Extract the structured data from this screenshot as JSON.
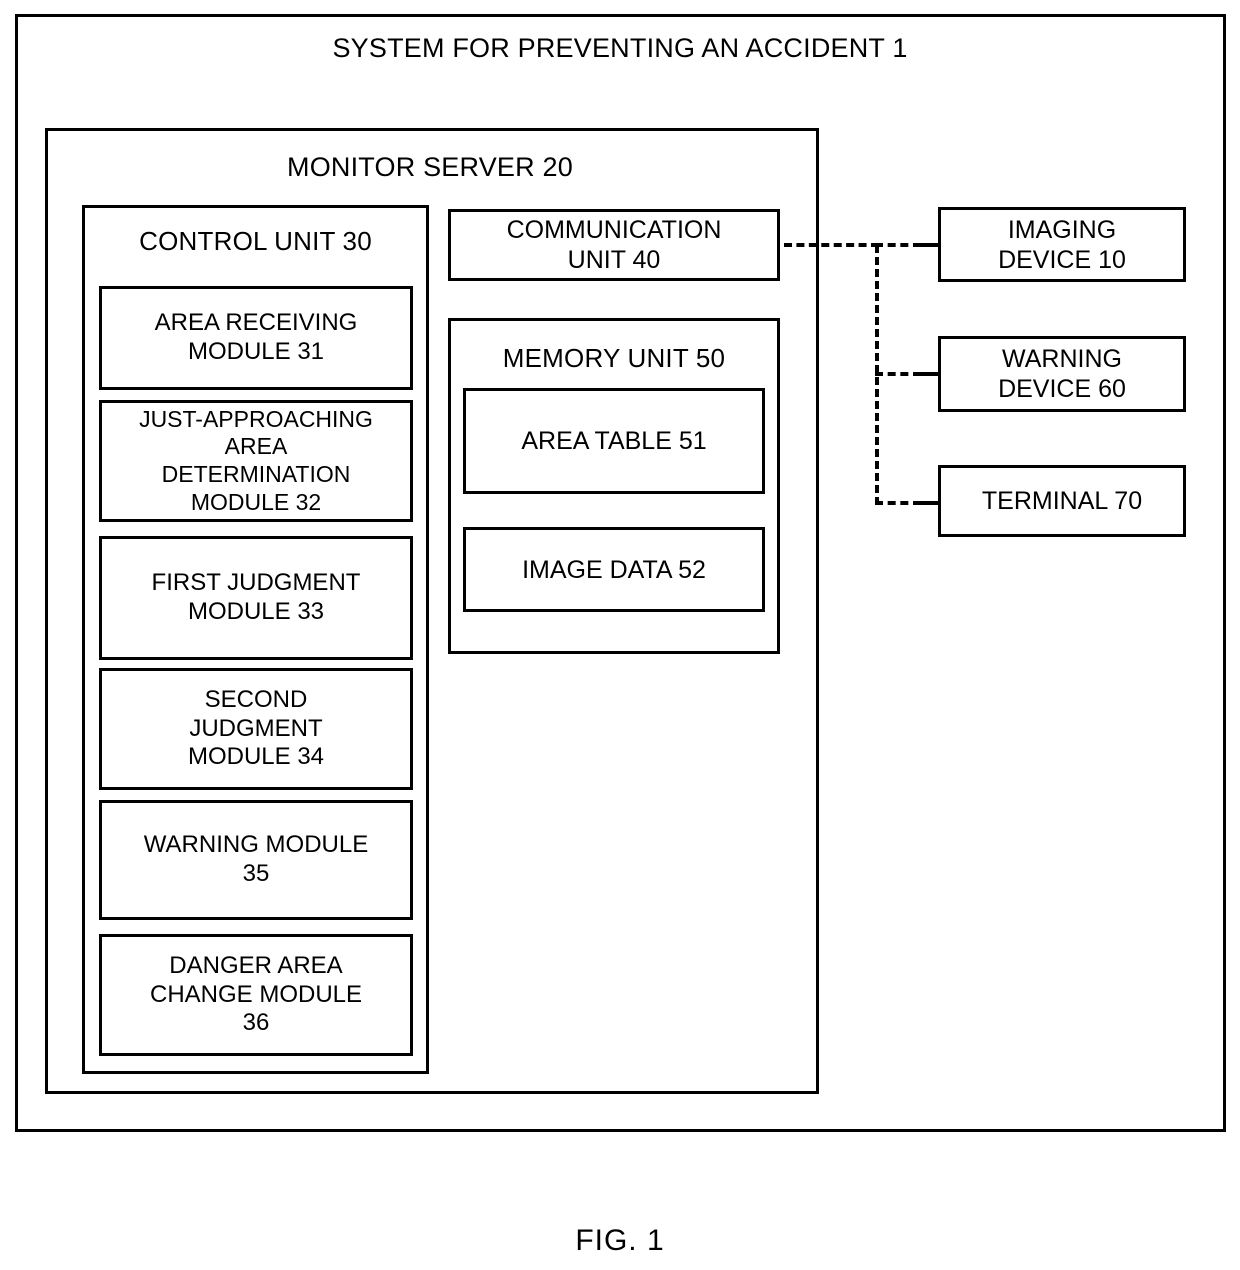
{
  "figure": {
    "caption": "FIG.  1",
    "system_title": "SYSTEM FOR PREVENTING AN ACCIDENT 1"
  },
  "monitor_server": {
    "title": "MONITOR SERVER 20",
    "control_unit": {
      "title": "CONTROL UNIT 30",
      "modules": [
        {
          "label": "AREA RECEIVING\nMODULE 31"
        },
        {
          "label": "JUST-APPROACHING\nAREA\nDETERMINATION\nMODULE 32"
        },
        {
          "label": "FIRST JUDGMENT\nMODULE 33"
        },
        {
          "label": "SECOND\nJUDGMENT\nMODULE 34"
        },
        {
          "label": "WARNING MODULE\n35"
        },
        {
          "label": "DANGER AREA\nCHANGE MODULE\n36"
        }
      ]
    },
    "communication_unit": {
      "label": "COMMUNICATION\nUNIT 40"
    },
    "memory_unit": {
      "title": "MEMORY UNIT 50",
      "items": [
        {
          "label": "AREA TABLE 51"
        },
        {
          "label": "IMAGE DATA 52"
        }
      ]
    }
  },
  "external_devices": [
    {
      "label": "IMAGING\nDEVICE 10"
    },
    {
      "label": "WARNING\nDEVICE 60"
    },
    {
      "label": "TERMINAL 70"
    }
  ],
  "colors": {
    "line": "#000000",
    "background": "#ffffff"
  }
}
